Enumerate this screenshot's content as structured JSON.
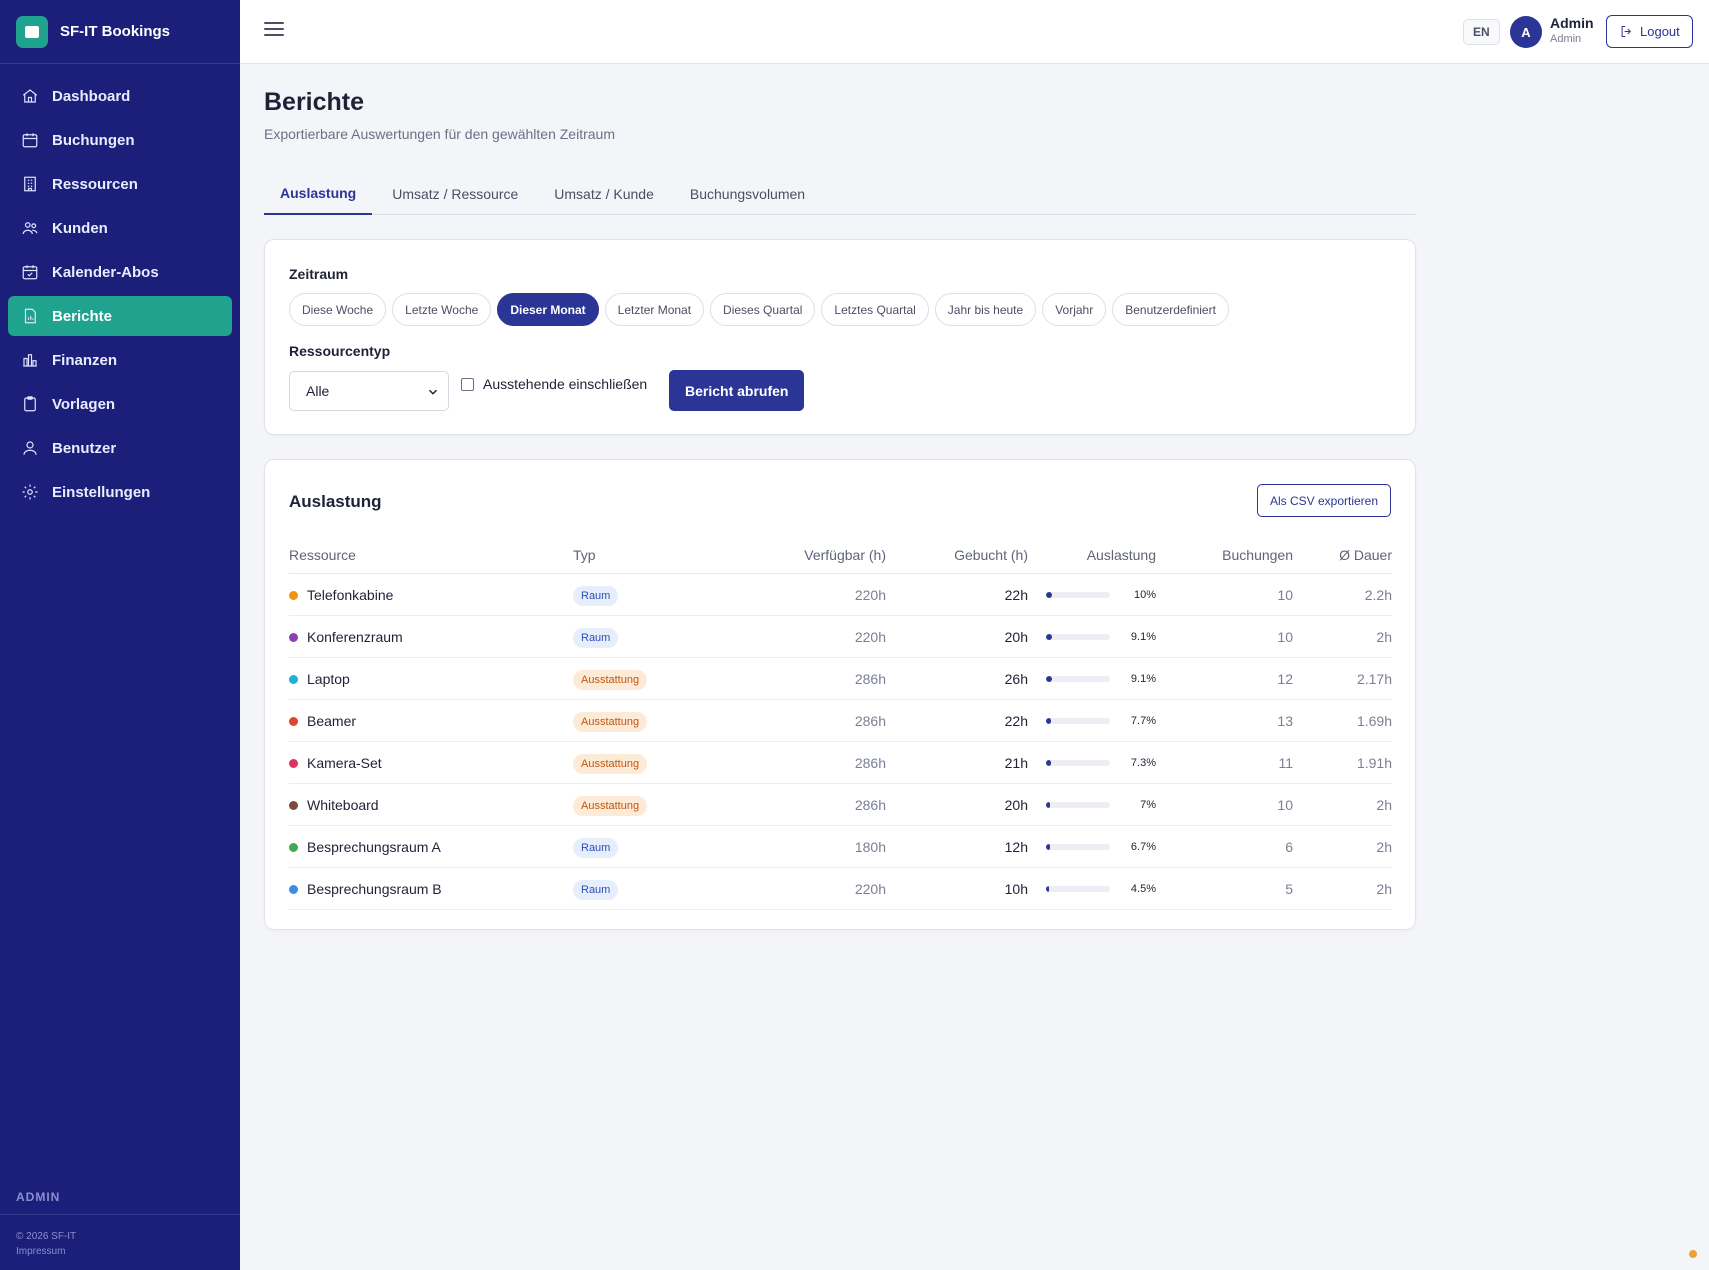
{
  "app": {
    "name": "SF-IT Bookings"
  },
  "sidebar": {
    "items": [
      {
        "label": "Dashboard",
        "icon": "home-icon"
      },
      {
        "label": "Buchungen",
        "icon": "calendar-icon"
      },
      {
        "label": "Ressourcen",
        "icon": "building-icon"
      },
      {
        "label": "Kunden",
        "icon": "users-icon"
      },
      {
        "label": "Kalender-Abos",
        "icon": "calendar-check-icon"
      },
      {
        "label": "Berichte",
        "icon": "report-icon",
        "active": true
      },
      {
        "label": "Finanzen",
        "icon": "bar-chart-icon"
      },
      {
        "label": "Vorlagen",
        "icon": "clipboard-icon"
      },
      {
        "label": "Benutzer",
        "icon": "user-icon"
      },
      {
        "label": "Einstellungen",
        "icon": "gear-icon"
      }
    ],
    "role_label": "ADMIN",
    "copyright": "© 2026 SF-IT",
    "impressum": "Impressum"
  },
  "topbar": {
    "lang": "EN",
    "avatar_initial": "A",
    "user_name": "Admin",
    "user_role": "Admin",
    "logout_label": "Logout"
  },
  "page": {
    "title": "Berichte",
    "subtitle": "Exportierbare Auswertungen für den gewählten Zeitraum"
  },
  "tabs": [
    {
      "label": "Auslastung",
      "active": true
    },
    {
      "label": "Umsatz / Ressource"
    },
    {
      "label": "Umsatz / Kunde"
    },
    {
      "label": "Buchungsvolumen"
    }
  ],
  "filters": {
    "period_label": "Zeitraum",
    "periods": [
      "Diese Woche",
      "Letzte Woche",
      "Dieser Monat",
      "Letzter Monat",
      "Dieses Quartal",
      "Letztes Quartal",
      "Jahr bis heute",
      "Vorjahr",
      "Benutzerdefiniert"
    ],
    "active_period": "Dieser Monat",
    "resource_type_label": "Ressourcentyp",
    "resource_type_value": "Alle",
    "include_pending_label": "Ausstehende einschließen",
    "include_pending": false,
    "submit_label": "Bericht abrufen"
  },
  "report": {
    "title": "Auslastung",
    "export_label": "Als CSV exportieren",
    "columns": [
      "Ressource",
      "Typ",
      "Verfügbar (h)",
      "Gebucht (h)",
      "Auslastung",
      "Buchungen",
      "Ø Dauer"
    ],
    "rows": [
      {
        "name": "Telefonkabine",
        "color": "#f2920f",
        "type": "Raum",
        "kind": "room",
        "available": "220h",
        "booked": "22h",
        "util": "10%",
        "util_value": 0.1,
        "bookings": "10",
        "duration": "2.2h"
      },
      {
        "name": "Konferenzraum",
        "color": "#8e3fb0",
        "type": "Raum",
        "kind": "room",
        "available": "220h",
        "booked": "20h",
        "util": "9.1%",
        "util_value": 0.091,
        "bookings": "10",
        "duration": "2h"
      },
      {
        "name": "Laptop",
        "color": "#1fb0d8",
        "type": "Ausstattung",
        "kind": "equip",
        "available": "286h",
        "booked": "26h",
        "util": "9.1%",
        "util_value": 0.091,
        "bookings": "12",
        "duration": "2.17h"
      },
      {
        "name": "Beamer",
        "color": "#e0432f",
        "type": "Ausstattung",
        "kind": "equip",
        "available": "286h",
        "booked": "22h",
        "util": "7.7%",
        "util_value": 0.077,
        "bookings": "13",
        "duration": "1.69h"
      },
      {
        "name": "Kamera-Set",
        "color": "#e0325e",
        "type": "Ausstattung",
        "kind": "equip",
        "available": "286h",
        "booked": "21h",
        "util": "7.3%",
        "util_value": 0.073,
        "bookings": "11",
        "duration": "1.91h"
      },
      {
        "name": "Whiteboard",
        "color": "#7a4d3b",
        "type": "Ausstattung",
        "kind": "equip",
        "available": "286h",
        "booked": "20h",
        "util": "7%",
        "util_value": 0.07,
        "bookings": "10",
        "duration": "2h"
      },
      {
        "name": "Besprechungsraum A",
        "color": "#43a853",
        "type": "Raum",
        "kind": "room",
        "available": "180h",
        "booked": "12h",
        "util": "6.7%",
        "util_value": 0.067,
        "bookings": "6",
        "duration": "2h"
      },
      {
        "name": "Besprechungsraum B",
        "color": "#3b8ee6",
        "type": "Raum",
        "kind": "room",
        "available": "220h",
        "booked": "10h",
        "util": "4.5%",
        "util_value": 0.045,
        "bookings": "5",
        "duration": "2h"
      }
    ]
  }
}
